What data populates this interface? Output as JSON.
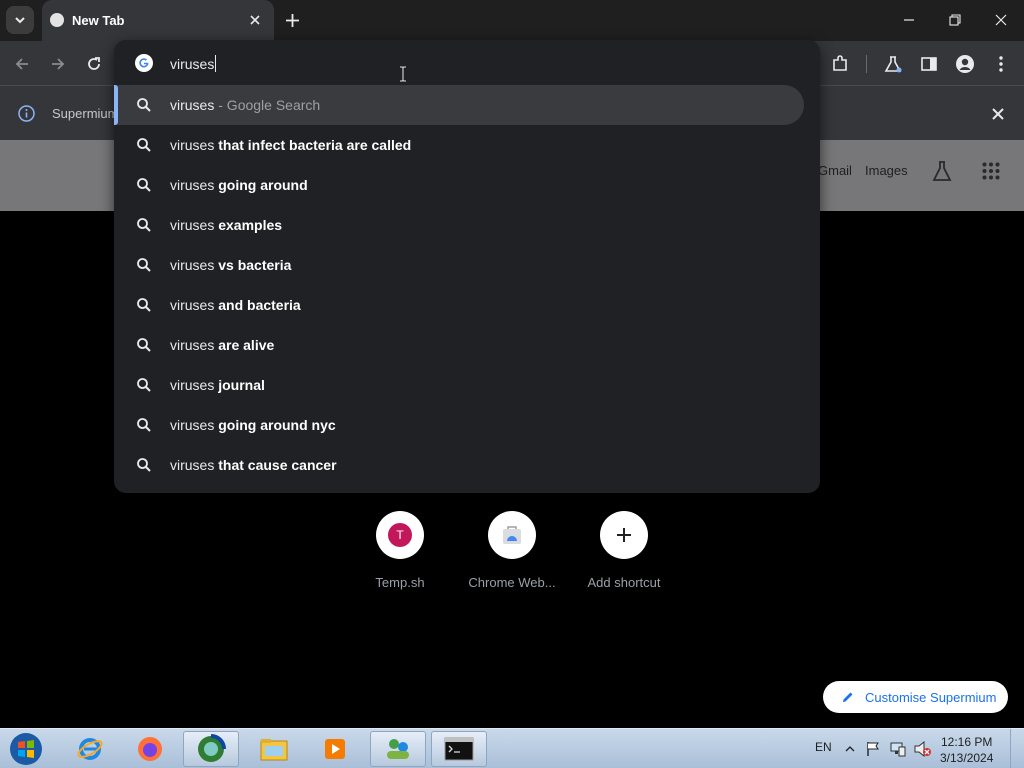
{
  "tab": {
    "title": "New Tab"
  },
  "infobar": {
    "text": "Supermium"
  },
  "google_header": {
    "gmail": "Gmail",
    "images": "Images"
  },
  "omnibox": {
    "query": "viruses",
    "suggestions": [
      {
        "prefix": "viruses",
        "bold": "",
        "sub": " - Google Search"
      },
      {
        "prefix": "viruses ",
        "bold": "that infect bacteria are called",
        "sub": ""
      },
      {
        "prefix": "viruses ",
        "bold": "going around",
        "sub": ""
      },
      {
        "prefix": "viruses ",
        "bold": "examples",
        "sub": ""
      },
      {
        "prefix": "viruses ",
        "bold": "vs bacteria",
        "sub": ""
      },
      {
        "prefix": "viruses ",
        "bold": "and bacteria",
        "sub": ""
      },
      {
        "prefix": "viruses ",
        "bold": "are alive",
        "sub": ""
      },
      {
        "prefix": "viruses ",
        "bold": "journal",
        "sub": ""
      },
      {
        "prefix": "viruses ",
        "bold": "going around nyc",
        "sub": ""
      },
      {
        "prefix": "viruses ",
        "bold": "that cause cancer",
        "sub": ""
      }
    ]
  },
  "shortcuts": [
    {
      "label": "Temp.sh",
      "letter": "T"
    },
    {
      "label": "Chrome Web...",
      "letter": ""
    },
    {
      "label": "Add shortcut",
      "letter": "+"
    }
  ],
  "customise": {
    "label": "Customise Supermium"
  },
  "taskbar": {
    "lang": "EN",
    "time": "12:16 PM",
    "date": "3/13/2024"
  },
  "colors": {
    "accent": "#8ab4f8",
    "link": "#1a73e8",
    "taskbar": "#b7c9de"
  },
  "icons": [
    "tab-search-icon",
    "close-icon",
    "plus-icon",
    "minimize-icon",
    "restore-icon",
    "back-icon",
    "forward-icon",
    "reload-icon",
    "extensions-icon",
    "labs-icon",
    "side-panel-icon",
    "profile-icon",
    "menu-icon",
    "info-icon",
    "search-icon",
    "google-g-icon",
    "apps-grid-icon",
    "pencil-icon"
  ]
}
